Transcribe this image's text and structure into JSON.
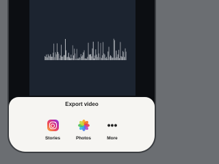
{
  "sheet": {
    "title": "Export video",
    "options": [
      {
        "label": "Stories",
        "icon": "instagram-icon"
      },
      {
        "label": "Photos",
        "icon": "photos-icon"
      },
      {
        "label": "More",
        "icon": "more-icon",
        "glyph": "•••"
      }
    ]
  },
  "colors": {
    "background": "#6b6e72",
    "video_bg": "#1c2430",
    "waveform": "#d4d7db",
    "sheet": "#f6f5f2"
  }
}
